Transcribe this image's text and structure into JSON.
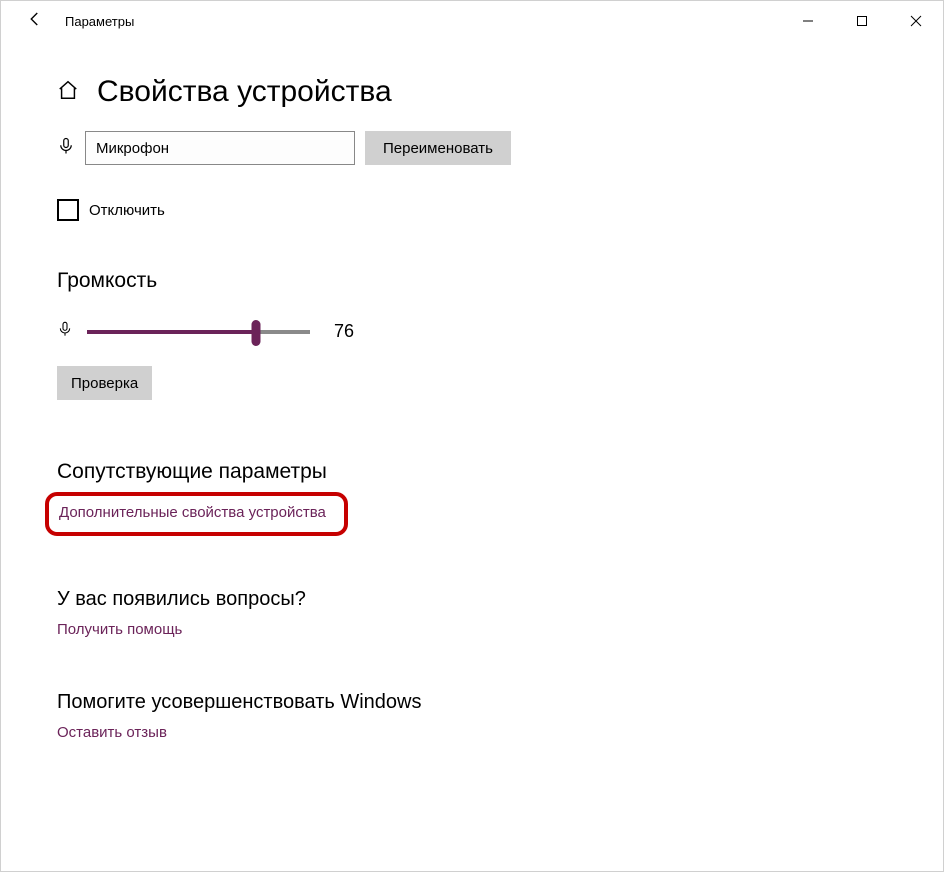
{
  "window": {
    "title": "Параметры"
  },
  "page": {
    "title": "Свойства устройства"
  },
  "device": {
    "name": "Микрофон",
    "rename_button": "Переименовать",
    "disable_label": "Отключить"
  },
  "volume": {
    "section_title": "Громкость",
    "value": 76,
    "test_button": "Проверка"
  },
  "related": {
    "section_title": "Сопутствующие параметры",
    "additional_link": "Дополнительные свойства устройства"
  },
  "help": {
    "section_title": "У вас появились вопросы?",
    "link": "Получить помощь"
  },
  "improve": {
    "section_title": "Помогите усовершенствовать Windows",
    "link": "Оставить отзыв"
  },
  "colors": {
    "accent": "#6b2359",
    "highlight": "#c60000"
  }
}
